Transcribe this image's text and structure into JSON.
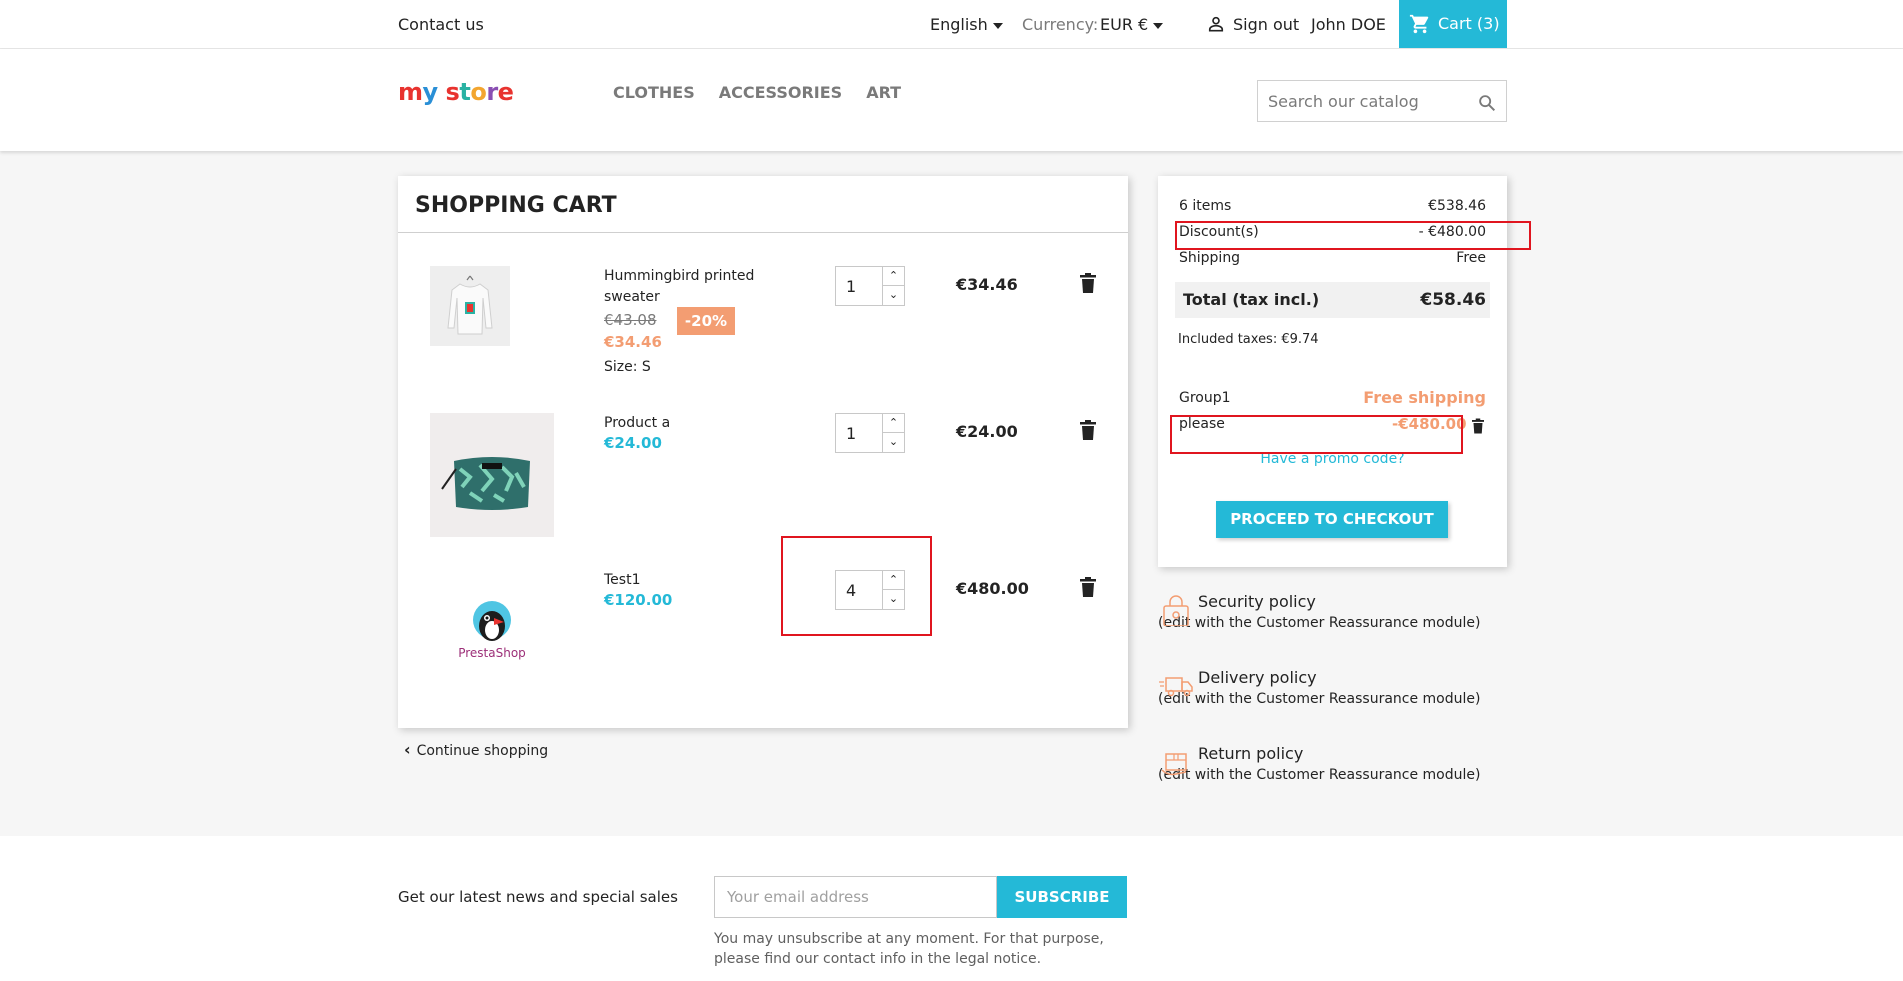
{
  "header": {
    "contact": "Contact us",
    "language": "English",
    "currency_label": "Currency:",
    "currency_value": "EUR €",
    "sign_out": "Sign out",
    "user_name": "John DOE",
    "cart_label": "Cart (3)"
  },
  "nav": {
    "logo": "my store",
    "menu": [
      "Clothes",
      "Accessories",
      "Art"
    ],
    "search_placeholder": "Search our catalog"
  },
  "cart": {
    "title": "Shopping Cart",
    "items": [
      {
        "name": "Hummingbird printed sweater",
        "old_price": "€43.08",
        "discount": "-20%",
        "price": "€34.46",
        "size_label": "Size:",
        "size_value": "S",
        "quantity": "1",
        "total": "€34.46"
      },
      {
        "name": "Product a",
        "price": "€24.00",
        "quantity": "1",
        "total": "€24.00"
      },
      {
        "name": "Test1",
        "price": "€120.00",
        "quantity": "4",
        "total": "€480.00",
        "image_brand": "PrestaShop"
      }
    ],
    "continue_shopping": "Continue shopping"
  },
  "summary": {
    "items_label": "6 items",
    "items_value": "€538.46",
    "discount_label": "Discount(s)",
    "discount_value": "- €480.00",
    "shipping_label": "Shipping",
    "shipping_value": "Free",
    "total_label": "Total (tax incl.)",
    "total_value": "€58.46",
    "taxes": "Included taxes: €9.74",
    "voucher1_name": "Group1",
    "voucher1_value": "Free shipping",
    "voucher2_name": "please",
    "voucher2_value": "-€480.00",
    "promo": "Have a promo code?",
    "checkout": "Proceed to checkout"
  },
  "reassurance": [
    {
      "title": "Security policy",
      "text": "(edit with the Customer Reassurance module)"
    },
    {
      "title": "Delivery policy",
      "text": "(edit with the Customer Reassurance module)"
    },
    {
      "title": "Return policy",
      "text": "(edit with the Customer Reassurance module)"
    }
  ],
  "newsletter": {
    "label": "Get our latest news and special sales",
    "placeholder": "Your email address",
    "button": "Subscribe",
    "note": "You may unsubscribe at any moment. For that purpose, please find our contact info in the legal notice."
  },
  "colors": {
    "accent": "#24b9d7",
    "discount": "#f39d72",
    "highlight": "#e0151f"
  }
}
